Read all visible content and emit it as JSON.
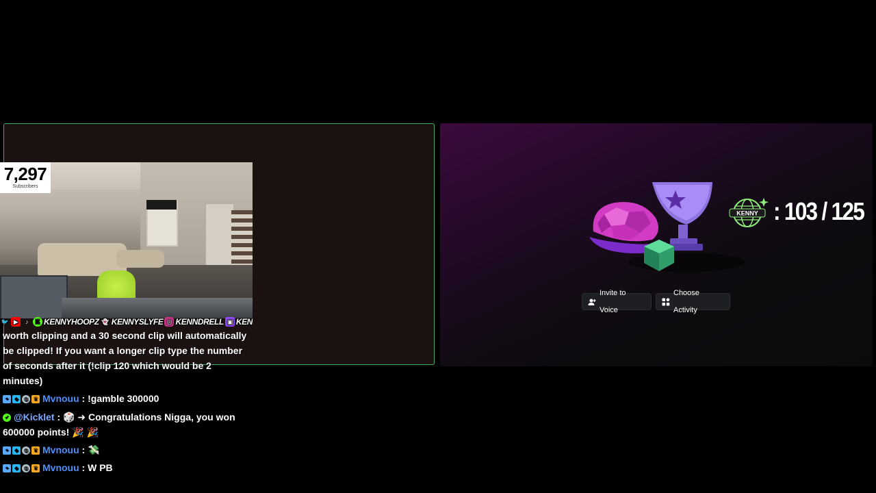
{
  "left_tile": {
    "subscribers": {
      "count": "7,297",
      "label": "Subscribers"
    },
    "socials": [
      {
        "icon": "twitter-icon",
        "glyph": "🐦",
        "handle": ""
      },
      {
        "icon": "youtube-icon",
        "glyph": "▶",
        "handle": ""
      },
      {
        "icon": "tiktok-icon",
        "glyph": "♪",
        "handle": ""
      },
      {
        "icon": "kick-icon",
        "glyph": "K",
        "handle": "KENNYHOOPZ"
      },
      {
        "icon": "snapchat-icon",
        "glyph": "👻",
        "handle": "KENNYSLYFE"
      },
      {
        "icon": "instagram-icon",
        "glyph": "◎",
        "handle": "KENNDRELL"
      },
      {
        "icon": "twitch-icon",
        "glyph": "▣",
        "handle": "KENNY"
      }
    ]
  },
  "chat": {
    "lines": [
      {
        "type": "text",
        "text": "worth clipping and a 30 second clip will automatically be clipped! If you want a longer clip type the number of seconds after it (!clip 120 which would be 2 minutes)"
      },
      {
        "type": "msg",
        "badges": [
          "pin",
          "gem",
          "globe",
          "crown"
        ],
        "user": "Mvnouu",
        "user_color": "#4f8ff7",
        "sep": " : ",
        "text": "!gamble 300000"
      },
      {
        "type": "msg",
        "badges": [
          "verified"
        ],
        "user": "@Kicklet",
        "user_color": "#7da8ff",
        "sep": " : ",
        "text": "🎲 ➜ Congratulations Nigga, you won 600000 points! 🎉 🎉"
      },
      {
        "type": "msg",
        "badges": [
          "pin",
          "gem",
          "globe",
          "crown"
        ],
        "user": "Mvnouu",
        "user_color": "#4f8ff7",
        "sep": " : ",
        "text": "💸"
      },
      {
        "type": "msg",
        "badges": [
          "pin",
          "gem",
          "globe",
          "crown"
        ],
        "user": "Mvnouu",
        "user_color": "#4f8ff7",
        "sep": " : ",
        "text": "W PB"
      }
    ]
  },
  "activity": {
    "counter": ": 103 / 125",
    "badge_text": "KENNY",
    "invite_label": "Invite to Voice",
    "choose_label": "Choose Activity"
  },
  "colors": {
    "speaking_border": "#3fae6a",
    "username_blue": "#4f8ff7",
    "button_bg": "#1e1f22"
  }
}
